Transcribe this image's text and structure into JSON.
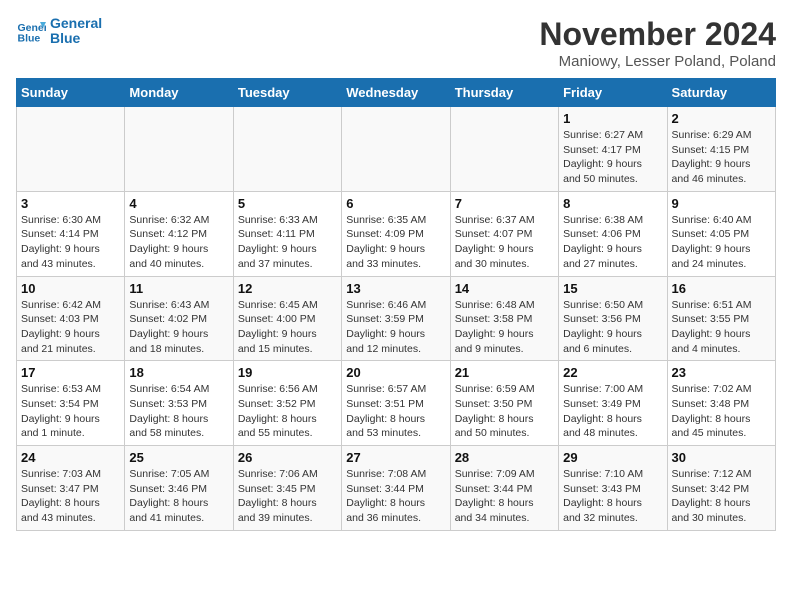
{
  "header": {
    "logo_line1": "General",
    "logo_line2": "Blue",
    "month": "November 2024",
    "location": "Maniowy, Lesser Poland, Poland"
  },
  "weekdays": [
    "Sunday",
    "Monday",
    "Tuesday",
    "Wednesday",
    "Thursday",
    "Friday",
    "Saturday"
  ],
  "weeks": [
    [
      {
        "day": "",
        "info": ""
      },
      {
        "day": "",
        "info": ""
      },
      {
        "day": "",
        "info": ""
      },
      {
        "day": "",
        "info": ""
      },
      {
        "day": "",
        "info": ""
      },
      {
        "day": "1",
        "info": "Sunrise: 6:27 AM\nSunset: 4:17 PM\nDaylight: 9 hours\nand 50 minutes."
      },
      {
        "day": "2",
        "info": "Sunrise: 6:29 AM\nSunset: 4:15 PM\nDaylight: 9 hours\nand 46 minutes."
      }
    ],
    [
      {
        "day": "3",
        "info": "Sunrise: 6:30 AM\nSunset: 4:14 PM\nDaylight: 9 hours\nand 43 minutes."
      },
      {
        "day": "4",
        "info": "Sunrise: 6:32 AM\nSunset: 4:12 PM\nDaylight: 9 hours\nand 40 minutes."
      },
      {
        "day": "5",
        "info": "Sunrise: 6:33 AM\nSunset: 4:11 PM\nDaylight: 9 hours\nand 37 minutes."
      },
      {
        "day": "6",
        "info": "Sunrise: 6:35 AM\nSunset: 4:09 PM\nDaylight: 9 hours\nand 33 minutes."
      },
      {
        "day": "7",
        "info": "Sunrise: 6:37 AM\nSunset: 4:07 PM\nDaylight: 9 hours\nand 30 minutes."
      },
      {
        "day": "8",
        "info": "Sunrise: 6:38 AM\nSunset: 4:06 PM\nDaylight: 9 hours\nand 27 minutes."
      },
      {
        "day": "9",
        "info": "Sunrise: 6:40 AM\nSunset: 4:05 PM\nDaylight: 9 hours\nand 24 minutes."
      }
    ],
    [
      {
        "day": "10",
        "info": "Sunrise: 6:42 AM\nSunset: 4:03 PM\nDaylight: 9 hours\nand 21 minutes."
      },
      {
        "day": "11",
        "info": "Sunrise: 6:43 AM\nSunset: 4:02 PM\nDaylight: 9 hours\nand 18 minutes."
      },
      {
        "day": "12",
        "info": "Sunrise: 6:45 AM\nSunset: 4:00 PM\nDaylight: 9 hours\nand 15 minutes."
      },
      {
        "day": "13",
        "info": "Sunrise: 6:46 AM\nSunset: 3:59 PM\nDaylight: 9 hours\nand 12 minutes."
      },
      {
        "day": "14",
        "info": "Sunrise: 6:48 AM\nSunset: 3:58 PM\nDaylight: 9 hours\nand 9 minutes."
      },
      {
        "day": "15",
        "info": "Sunrise: 6:50 AM\nSunset: 3:56 PM\nDaylight: 9 hours\nand 6 minutes."
      },
      {
        "day": "16",
        "info": "Sunrise: 6:51 AM\nSunset: 3:55 PM\nDaylight: 9 hours\nand 4 minutes."
      }
    ],
    [
      {
        "day": "17",
        "info": "Sunrise: 6:53 AM\nSunset: 3:54 PM\nDaylight: 9 hours\nand 1 minute."
      },
      {
        "day": "18",
        "info": "Sunrise: 6:54 AM\nSunset: 3:53 PM\nDaylight: 8 hours\nand 58 minutes."
      },
      {
        "day": "19",
        "info": "Sunrise: 6:56 AM\nSunset: 3:52 PM\nDaylight: 8 hours\nand 55 minutes."
      },
      {
        "day": "20",
        "info": "Sunrise: 6:57 AM\nSunset: 3:51 PM\nDaylight: 8 hours\nand 53 minutes."
      },
      {
        "day": "21",
        "info": "Sunrise: 6:59 AM\nSunset: 3:50 PM\nDaylight: 8 hours\nand 50 minutes."
      },
      {
        "day": "22",
        "info": "Sunrise: 7:00 AM\nSunset: 3:49 PM\nDaylight: 8 hours\nand 48 minutes."
      },
      {
        "day": "23",
        "info": "Sunrise: 7:02 AM\nSunset: 3:48 PM\nDaylight: 8 hours\nand 45 minutes."
      }
    ],
    [
      {
        "day": "24",
        "info": "Sunrise: 7:03 AM\nSunset: 3:47 PM\nDaylight: 8 hours\nand 43 minutes."
      },
      {
        "day": "25",
        "info": "Sunrise: 7:05 AM\nSunset: 3:46 PM\nDaylight: 8 hours\nand 41 minutes."
      },
      {
        "day": "26",
        "info": "Sunrise: 7:06 AM\nSunset: 3:45 PM\nDaylight: 8 hours\nand 39 minutes."
      },
      {
        "day": "27",
        "info": "Sunrise: 7:08 AM\nSunset: 3:44 PM\nDaylight: 8 hours\nand 36 minutes."
      },
      {
        "day": "28",
        "info": "Sunrise: 7:09 AM\nSunset: 3:44 PM\nDaylight: 8 hours\nand 34 minutes."
      },
      {
        "day": "29",
        "info": "Sunrise: 7:10 AM\nSunset: 3:43 PM\nDaylight: 8 hours\nand 32 minutes."
      },
      {
        "day": "30",
        "info": "Sunrise: 7:12 AM\nSunset: 3:42 PM\nDaylight: 8 hours\nand 30 minutes."
      }
    ]
  ]
}
